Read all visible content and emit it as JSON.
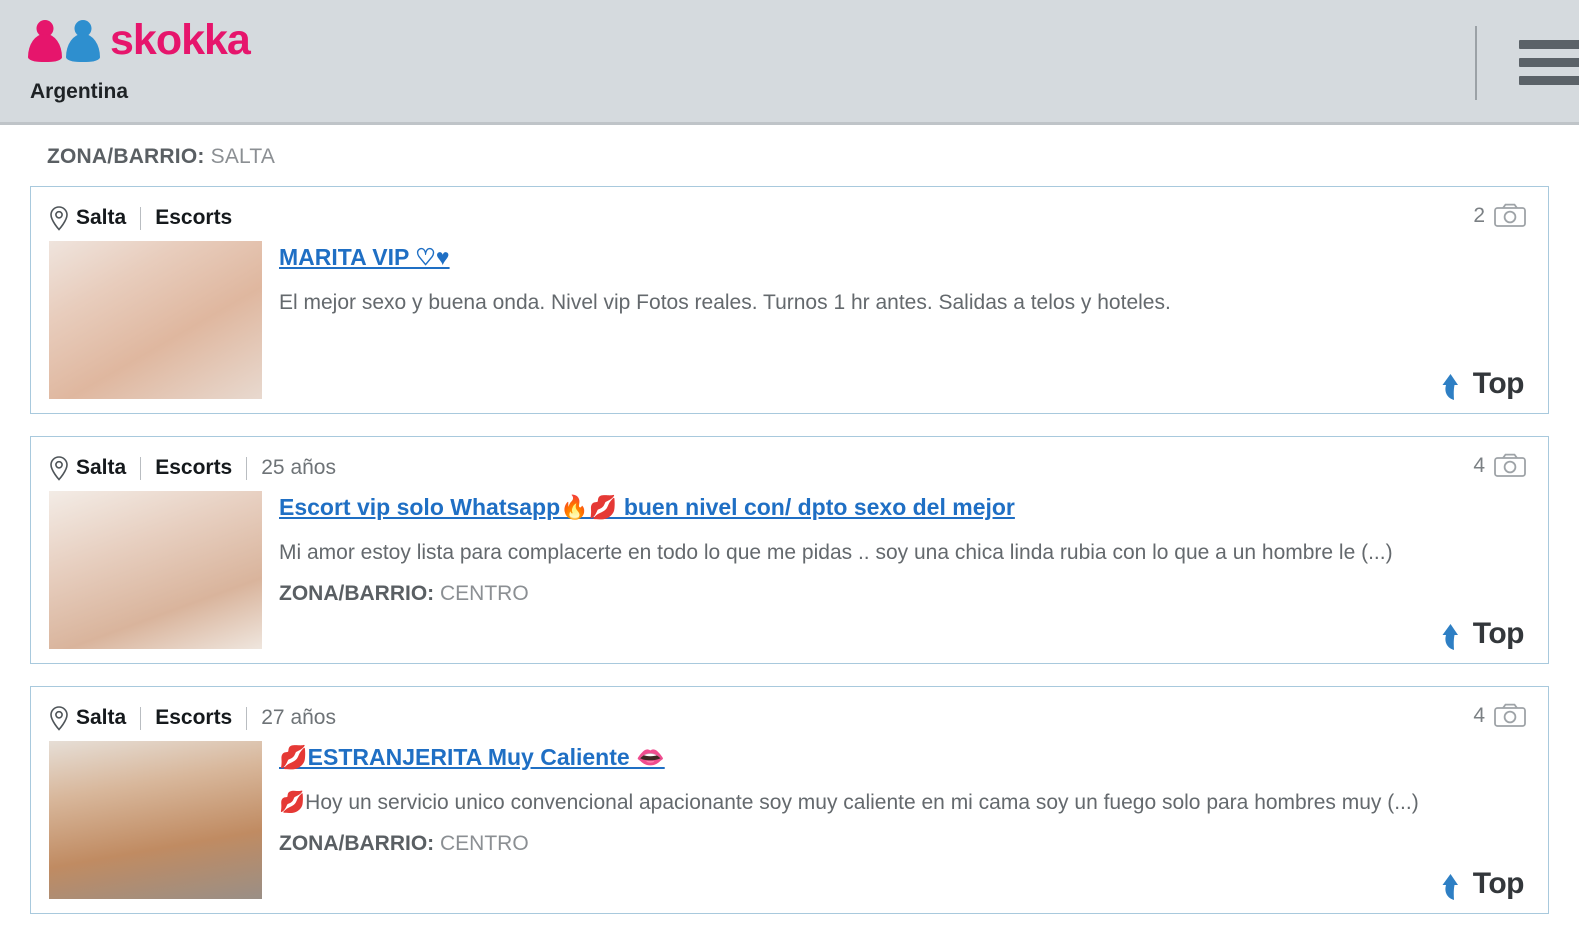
{
  "header": {
    "brand_name": "skokka",
    "country": "Argentina",
    "logo_icon": "two-people-icon",
    "menu_icon": "hamburger-menu-icon",
    "brand_color": "#e6156c",
    "accent_blue": "#2e8fcf"
  },
  "page": {
    "zona_label": "ZONA/BARRIO:",
    "zona_value": "SALTA"
  },
  "listings": [
    {
      "city": "Salta",
      "category": "Escorts",
      "age": "",
      "photo_count": "2",
      "title": "MARITA VIP ♡♥",
      "description": "El mejor sexo y buena onda. Nivel vip Fotos reales. Turnos 1 hr antes. Salidas a telos y hoteles.",
      "zona_label": "",
      "zona_value": "",
      "top_badge": "Top",
      "has_top": true
    },
    {
      "city": "Salta",
      "category": "Escorts",
      "age": "25 años",
      "photo_count": "4",
      "title": "Escort vip solo Whatsapp🔥💋 buen nivel con/ dpto sexo del mejor",
      "description": "Mi amor estoy lista para complacerte en todo lo que me pidas .. soy una chica linda rubia con lo que a un hombre le (...)",
      "zona_label": "ZONA/BARRIO:",
      "zona_value": "CENTRO",
      "top_badge": "Top",
      "has_top": true
    },
    {
      "city": "Salta",
      "category": "Escorts",
      "age": "27 años",
      "photo_count": "4",
      "title": "💋ESTRANJERITA Muy Caliente 👄",
      "description": "💋Hoy un servicio unico convencional apacionante soy muy caliente en mi cama soy un fuego solo para hombres muy (...)",
      "zona_label": "ZONA/BARRIO:",
      "zona_value": "CENTRO",
      "top_badge": "Top",
      "has_top": true
    }
  ]
}
